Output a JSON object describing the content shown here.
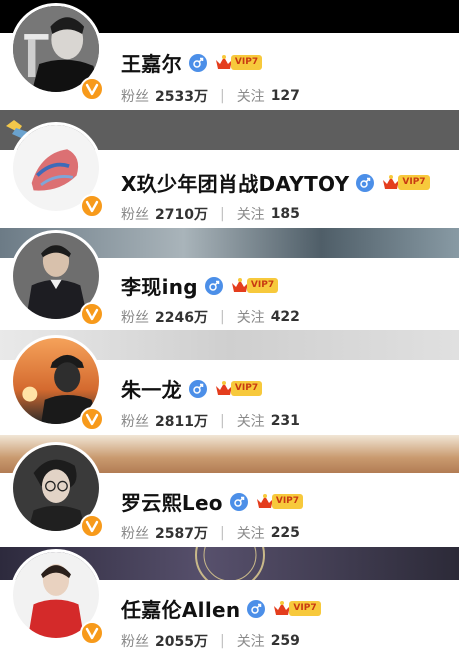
{
  "labels": {
    "fans": "粉丝",
    "following": "关注",
    "vip_tag": "VIP7",
    "separator": "|"
  },
  "users": [
    {
      "name": "王嘉尔",
      "fans": "2533万",
      "following": "127"
    },
    {
      "name": "X玖少年团肖战DAYTOY",
      "fans": "2710万",
      "following": "185"
    },
    {
      "name": "李现ing",
      "fans": "2246万",
      "following": "422"
    },
    {
      "name": "朱一龙",
      "fans": "2811万",
      "following": "231"
    },
    {
      "name": "罗云熙Leo",
      "fans": "2587万",
      "following": "225"
    },
    {
      "name": "任嘉伦Allen",
      "fans": "2055万",
      "following": "259"
    }
  ],
  "icons": {
    "gender": "male-icon",
    "verified": "verified-v-badge-icon",
    "vip": "crown-vip-icon"
  },
  "colors": {
    "gender_blue": "#4c8fe8",
    "verified_orange": "#f79a1b",
    "vip_gold": "#f7c93c"
  }
}
